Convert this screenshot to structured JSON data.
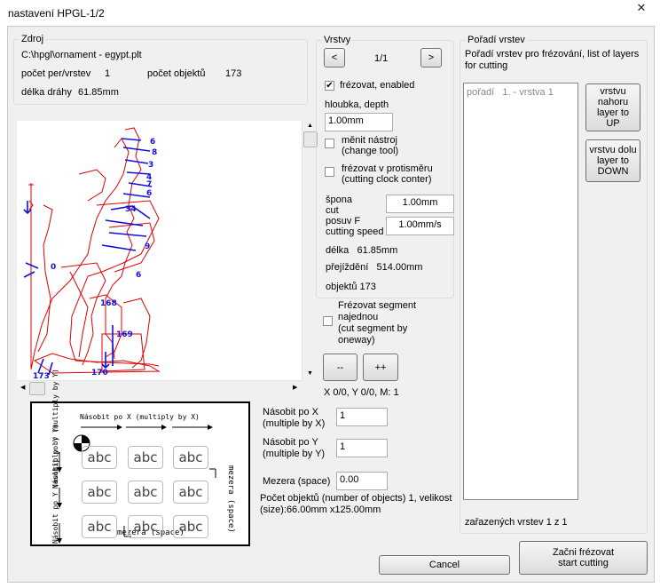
{
  "window": {
    "title": "nastavení HPGL-1/2",
    "close_glyph": "✕"
  },
  "zdroj": {
    "legend": "Zdroj",
    "file_path": "C:\\hpgl\\ornament - egypt.plt",
    "per_label": "počet per/vrstev",
    "per_value": "1",
    "obj_label": "počet objektů",
    "obj_value": "173",
    "length_label": "délka dráhy",
    "length_value": "61.85mm"
  },
  "vrstvy": {
    "legend": "Vrstvy",
    "prev": "<",
    "page": "1/1",
    "next": ">",
    "mill_enabled": "frézovat, enabled",
    "depth_label": "hloubka, depth",
    "depth_value": "1.00mm",
    "change_tool": "měnit nástroj\n(change tool)",
    "counter_dir": "frézovat v protisměru\n(cutting clock conter)",
    "cut_label": "špona\ncut",
    "cut_value": "1.00mm",
    "feed_label": "posuv F\ncutting speed",
    "feed_value": "1.00mm/s",
    "length_text": "délka   61.85mm",
    "travel_text": "přejíždění   514.00mm",
    "objects_text": "objektů 173"
  },
  "segment": {
    "label": "Frézovat segment\nnajednou\n(cut segment by\noneway)"
  },
  "zoom": {
    "minus": "--",
    "plus": "++",
    "coords": "X 0/0, Y 0/0, M: 1"
  },
  "preview": {
    "labels": [
      "6",
      "8",
      "3",
      "4",
      "7",
      "6",
      "34",
      "9",
      "6",
      "168",
      "169",
      "0",
      "173",
      "170"
    ]
  },
  "multiply": {
    "x_label": "Násobit po X\n(multiple by X)",
    "x_value": "1",
    "y_label": "Násobit po Y\n(multiple by Y)",
    "y_value": "1",
    "space_label": "Mezera (space)",
    "space_value": "0.00",
    "summary": "Počet objektů (number of objects) 1, velikost\n(size):66.00mm x125.00mm"
  },
  "demo": {
    "top_label": "Násobit po X (multiply by X)",
    "left_label": "Násobit po Y (multiply by Y)",
    "left_label2": "Násobit po Y (multiply by Y)",
    "right_label": "mezera (space)",
    "bottom_label": "mezera (space)",
    "cell_text": "abc"
  },
  "order": {
    "legend": "Pořadí vrstev",
    "description": "Pořadí vrstev pro frézování, list of layers\nfor cutting",
    "list_item": "pořadí   1. - vrstva 1",
    "up_button": "vrstvu\nnahoru\nlayer to\nUP",
    "down_button": "vrstvu dolu\nlayer to\nDOWN",
    "count_text": "zařazených vrstev 1 z 1"
  },
  "footer": {
    "cancel": "Cancel",
    "start": "Začni frézovat\nstart cutting"
  }
}
